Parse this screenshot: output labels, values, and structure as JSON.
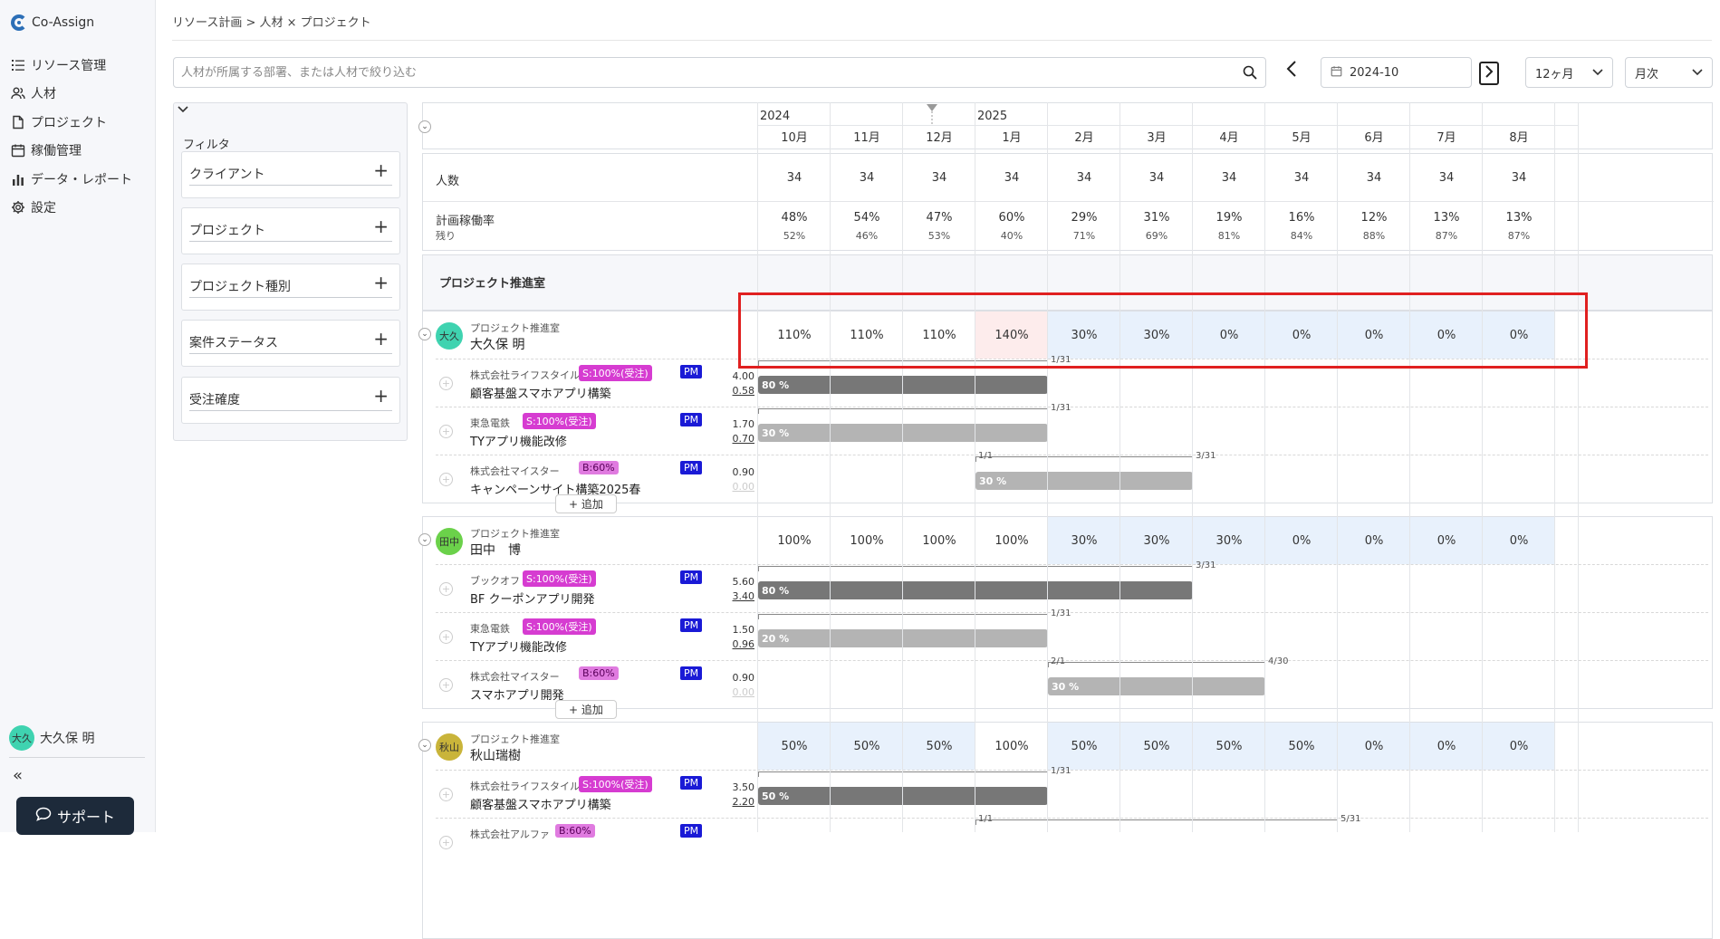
{
  "app": {
    "name": "Co-Assign"
  },
  "nav": [
    {
      "label": "リソース管理",
      "icon": "list-icon"
    },
    {
      "label": "人材",
      "icon": "people-icon"
    },
    {
      "label": "プロジェクト",
      "icon": "document-icon"
    },
    {
      "label": "稼働管理",
      "icon": "calendar-icon"
    },
    {
      "label": "データ・レポート",
      "icon": "bar-chart-icon"
    },
    {
      "label": "設定",
      "icon": "gear-icon"
    }
  ],
  "current_user": {
    "name": "大久保 明",
    "avatar": "大久"
  },
  "support_label": "サポート",
  "breadcrumb": "リソース計画 > 人材 × プロジェクト",
  "search": {
    "placeholder": "人材が所属する部署、または人材で絞り込む",
    "value": ""
  },
  "date_picker": {
    "value": "2024-10"
  },
  "period_select": {
    "value": "12ヶ月"
  },
  "unit_select": {
    "value": "月次"
  },
  "filter": {
    "title": "フィルタ",
    "items": [
      "クライアント",
      "プロジェクト",
      "プロジェクト種別",
      "案件ステータス",
      "受注確度"
    ]
  },
  "timeline": {
    "years": [
      "2024",
      "2025"
    ],
    "months": [
      "10月",
      "11月",
      "12月",
      "1月",
      "2月",
      "3月",
      "4月",
      "5月",
      "6月",
      "7月",
      "8月"
    ]
  },
  "summary": {
    "headcount_label": "人数",
    "headcount": [
      "34",
      "34",
      "34",
      "34",
      "34",
      "34",
      "34",
      "34",
      "34",
      "34",
      "34"
    ],
    "rate_label": "計画稼働率",
    "remain_label": "残り",
    "rates": [
      "48%",
      "54%",
      "47%",
      "60%",
      "29%",
      "31%",
      "19%",
      "16%",
      "12%",
      "13%",
      "13%"
    ],
    "remains": [
      "52%",
      "46%",
      "53%",
      "40%",
      "71%",
      "69%",
      "81%",
      "84%",
      "88%",
      "87%",
      "87%"
    ]
  },
  "department": {
    "name": "プロジェクト推進室"
  },
  "add_label": "+ 追加",
  "pm_label": "PM",
  "people": [
    {
      "dept": "プロジェクト推進室",
      "name": "大久保 明",
      "avatar": "大久",
      "avatar_color": "#3fd3b0",
      "alloc": [
        "110%",
        "110%",
        "110%",
        "140%",
        "30%",
        "30%",
        "0%",
        "0%",
        "0%",
        "0%",
        "0%"
      ],
      "projects": [
        {
          "client": "株式会社ライフスタイル",
          "tag": "S:100%(受注)",
          "name": "顧客基盤スマホアプリ構築",
          "top": "4.00",
          "bot": "0.58",
          "bar": "80 %",
          "end": "1/31",
          "start": ""
        },
        {
          "client": "東急電鉄",
          "tag": "S:100%(受注)",
          "name": "TYアプリ機能改修",
          "top": "1.70",
          "bot": "0.70",
          "bar": "30 %",
          "end": "1/31",
          "start": ""
        },
        {
          "client": "株式会社マイスター",
          "tag": "B:60%",
          "name": "キャンペーンサイト構築2025春",
          "top": "0.90",
          "bot": "0.00",
          "bar": "30 %",
          "end": "3/31",
          "start": "1/1"
        }
      ]
    },
    {
      "dept": "プロジェクト推進室",
      "name": "田中　博",
      "avatar": "田中",
      "avatar_color": "#6bd14a",
      "alloc": [
        "100%",
        "100%",
        "100%",
        "100%",
        "30%",
        "30%",
        "30%",
        "0%",
        "0%",
        "0%",
        "0%"
      ],
      "projects": [
        {
          "client": "ブックオフ",
          "tag": "S:100%(受注)",
          "name": "BF クーポンアプリ開発",
          "top": "5.60",
          "bot": "3.40",
          "bar": "80 %",
          "end": "3/31",
          "start": ""
        },
        {
          "client": "東急電鉄",
          "tag": "S:100%(受注)",
          "name": "TYアプリ機能改修",
          "top": "1.50",
          "bot": "0.96",
          "bar": "20 %",
          "end": "1/31",
          "start": ""
        },
        {
          "client": "株式会社マイスター",
          "tag": "B:60%",
          "name": "スマホアプリ開発",
          "top": "0.90",
          "bot": "0.00",
          "bar": "30 %",
          "end": "4/30",
          "start": "2/1"
        }
      ]
    },
    {
      "dept": "プロジェクト推進室",
      "name": "秋山瑞樹",
      "avatar": "秋山",
      "avatar_color": "#c9b43a",
      "alloc": [
        "50%",
        "50%",
        "50%",
        "100%",
        "50%",
        "50%",
        "50%",
        "50%",
        "0%",
        "0%",
        "0%"
      ],
      "projects": [
        {
          "client": "株式会社ライフスタイル",
          "tag": "S:100%(受注)",
          "name": "顧客基盤スマホアプリ構築",
          "top": "3.50",
          "bot": "2.20",
          "bar": "50 %",
          "end": "1/31",
          "start": ""
        },
        {
          "client": "株式会社アルファ",
          "tag": "B:60%",
          "name": "",
          "top": "",
          "bot": "",
          "bar": "",
          "end": "5/31",
          "start": "1/1"
        }
      ]
    }
  ]
}
